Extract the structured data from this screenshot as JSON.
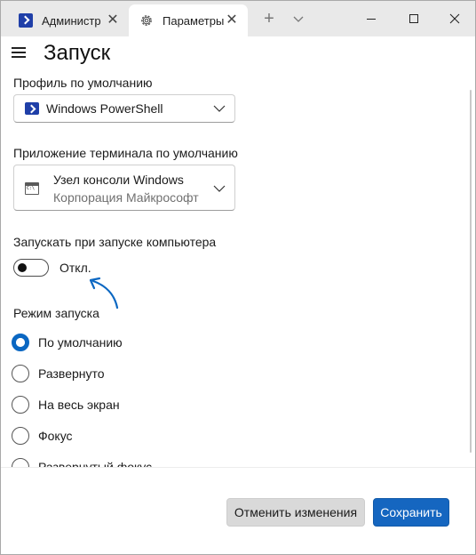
{
  "tabs": [
    {
      "label": "Администр",
      "icon": "powershell-icon"
    },
    {
      "label": "Параметры",
      "icon": "gear-icon"
    }
  ],
  "header": {
    "title": "Запуск"
  },
  "default_profile": {
    "label": "Профиль по умолчанию",
    "value": "Windows PowerShell"
  },
  "default_terminal": {
    "label": "Приложение терминала по умолчанию",
    "value": "Узел консоли Windows",
    "sublabel": "Корпорация Майкрософт"
  },
  "launch_on_startup": {
    "label": "Запускать при запуске компьютера",
    "state_text": "Откл.",
    "on": false
  },
  "launch_mode": {
    "label": "Режим запуска",
    "options": [
      "По умолчанию",
      "Развернуто",
      "На весь экран",
      "Фокус",
      "Развернутый фокус"
    ],
    "selected": "По умолчанию"
  },
  "footer": {
    "cancel_label": "Отменить изменения",
    "save_label": "Сохранить"
  },
  "colors": {
    "accent": "#1566c0",
    "annotation_arrow": "#0a67c2"
  }
}
